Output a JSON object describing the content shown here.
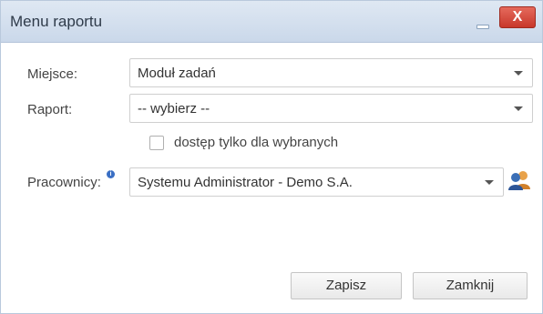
{
  "window": {
    "title": "Menu raportu",
    "close_label": "X"
  },
  "form": {
    "place": {
      "label": "Miejsce:",
      "value": "Moduł zadań"
    },
    "report": {
      "label": "Raport:",
      "value": "-- wybierz --"
    },
    "restricted": {
      "label": "dostęp tylko dla wybranych",
      "checked": false
    },
    "employees": {
      "label": "Pracownicy:",
      "value": "Systemu Administrator - Demo S.A."
    }
  },
  "buttons": {
    "save": "Zapisz",
    "close": "Zamknij"
  },
  "colors": {
    "titlebar": "#cad8ea",
    "close_button": "#c8372b",
    "info_icon": "#3a6fc4"
  }
}
